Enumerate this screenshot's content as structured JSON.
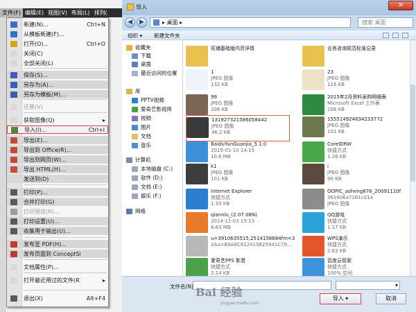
{
  "menubar": {
    "items": [
      "文件(F)",
      "编辑(E)",
      "视图(V)",
      "布局(L)",
      "排列("
    ],
    "active_index": 0
  },
  "file_menu": {
    "items": [
      {
        "label": "新建(N)...",
        "shortcut": "Ctrl+N",
        "color": "#3a6fc8"
      },
      {
        "label": "从模板新建(F)...",
        "shortcut": "",
        "color": "#3a6fc8"
      },
      {
        "label": "打开(O)...",
        "shortcut": "Ctrl+O",
        "color": "#d6a21e"
      },
      {
        "label": "关闭(C)",
        "shortcut": "",
        "color": "#d8d8d8"
      },
      {
        "label": "全部关闭(L)",
        "shortcut": "",
        "color": "#d8d8d8"
      },
      {
        "label": "保存(S)...",
        "shortcut": "",
        "color": "#3a5fb0"
      },
      {
        "label": "另存为(A)...",
        "shortcut": "",
        "color": "#3a5fb0"
      },
      {
        "label": "另存为模板(M)...",
        "shortcut": "",
        "color": "#3a5fb0"
      },
      {
        "label": "还原(V)",
        "shortcut": "",
        "color": "#d8d8d8",
        "disabled": true
      },
      {
        "label": "获取图像(Q)",
        "shortcut": "",
        "color": "#d8d8d8",
        "submenu": true
      },
      {
        "label": "导入(I)...",
        "shortcut": "Ctrl+I",
        "color": "#4f8a3a"
      },
      {
        "label": "导出(E)...",
        "shortcut": "",
        "color": "#c44b3a"
      },
      {
        "label": "导出到 Office(R)...",
        "shortcut": "",
        "color": "#c44b3a"
      },
      {
        "label": "导出到网页(W)...",
        "shortcut": "",
        "color": "#c44b3a"
      },
      {
        "label": "导出 HTML(H)...",
        "shortcut": "",
        "color": "#c44b3a"
      },
      {
        "label": "发送到(D)",
        "shortcut": "",
        "color": "#d8d8d8"
      },
      {
        "label": "打印(P)...",
        "shortcut": "",
        "color": "#5a5a5a"
      },
      {
        "label": "合并打印(G)",
        "shortcut": "",
        "color": "#5a5a5a"
      },
      {
        "label": "打印预览(R)...",
        "shortcut": "",
        "color": "#9a9a9a",
        "disabled": true
      },
      {
        "label": "打印设置(U)...",
        "shortcut": "",
        "color": "#5a5a5a"
      },
      {
        "label": "收集用于输出(U)...",
        "shortcut": "",
        "color": "#5a5a5a"
      },
      {
        "label": "发布至 PDF(H)...",
        "shortcut": "",
        "color": "#c0392b"
      },
      {
        "label": "发布页面到 ConceptShare(I)...",
        "shortcut": "",
        "color": "#c0392b"
      },
      {
        "label": "文档属性(P)...",
        "shortcut": "",
        "color": "#d8d8d8"
      },
      {
        "label": "打开最近用过的文件(R)",
        "shortcut": "",
        "color": "#d8d8d8",
        "submenu": true
      },
      {
        "label": "退出(X)",
        "shortcut": "Alt+F4",
        "color": "#5a5a5a"
      }
    ]
  },
  "dialog": {
    "title": "导入",
    "close_label": "✕",
    "breadcrumb": "▸ 桌面 ▸",
    "search_placeholder": "搜索 桌面",
    "toolbar": {
      "organize": "组织 ▾",
      "new_folder": "新建文件夹"
    },
    "nav": [
      {
        "label": "收藏夹",
        "color": "#e6b32e",
        "indent": 0
      },
      {
        "label": "下载",
        "color": "#6a8fc4",
        "indent": 1
      },
      {
        "label": "桌面",
        "color": "#5e7fb8",
        "indent": 1
      },
      {
        "label": "最近访问的位置",
        "color": "#9cb3d6",
        "indent": 1
      },
      {
        "label": "库",
        "color": "#d9b54a",
        "indent": 0
      },
      {
        "label": "PPTV视频",
        "color": "#2f7fd6",
        "indent": 1
      },
      {
        "label": "爱奇艺影视库",
        "color": "#46a345",
        "indent": 1
      },
      {
        "label": "视频",
        "color": "#8d6fc0",
        "indent": 1
      },
      {
        "label": "图片",
        "color": "#4b8bc9",
        "indent": 1
      },
      {
        "label": "文档",
        "color": "#d8c26a",
        "indent": 1
      },
      {
        "label": "音乐",
        "color": "#4f8fd0",
        "indent": 1
      },
      {
        "label": "计算机",
        "color": "#7a8aa1",
        "indent": 0
      },
      {
        "label": "本地磁盘 (C:)",
        "color": "#9aa7b8",
        "indent": 1
      },
      {
        "label": "软件 (D:)",
        "color": "#9aa7b8",
        "indent": 1
      },
      {
        "label": "文档 (E:)",
        "color": "#9aa7b8",
        "indent": 1
      },
      {
        "label": "娱乐 (F:)",
        "color": "#9aa7b8",
        "indent": 1
      },
      {
        "label": "网络",
        "color": "#5a7bb0",
        "indent": 0
      }
    ],
    "files": [
      {
        "name": "旺铺基础版内页详情",
        "meta1": "",
        "meta2": "",
        "thumb": "#e7c24f",
        "col": 0
      },
      {
        "name": "业务咨询规范标准记录",
        "meta1": "",
        "meta2": "",
        "thumb": "#e7c24f",
        "col": 1
      },
      {
        "name": "1",
        "meta1": "JPEG 图像",
        "meta2": "132 KB",
        "thumb": "#eef3fa",
        "col": 0
      },
      {
        "name": "23",
        "meta1": "JPEG 图像",
        "meta2": "116 KB",
        "thumb": "#ece2c8",
        "col": 1
      },
      {
        "name": "99",
        "meta1": "JPEG 图像",
        "meta2": "206 KB",
        "thumb": "#7a6656",
        "col": 0
      },
      {
        "name": "2015年2月资料采购明细表",
        "meta1": "Microsoft Excel 工作表",
        "meta2": "206 KB",
        "thumb": "#2e8a3f",
        "col": 1
      },
      {
        "name": "131927321586058442",
        "meta1": "JPEG 图像",
        "meta2": "46.2 KB",
        "thumb": "#3a3a3a",
        "col": 0,
        "selected": true
      },
      {
        "name": "155514924634233772",
        "meta1": "JPEG 图像",
        "meta2": "101 KB",
        "thumb": "#6d7a4f",
        "col": 1
      },
      {
        "name": "BaiduYunGuanjia_5.1.0",
        "meta1": "2015-01-10 14:15",
        "meta2": "10.6 MB",
        "thumb": "#3c8fd8",
        "col": 0
      },
      {
        "name": "CorelDRW",
        "meta1": "快捷方式",
        "meta2": "1.26 KB",
        "thumb": "#48a84a",
        "col": 1
      },
      {
        "name": "k1",
        "meta1": "JPEG 图像",
        "meta2": "101 KB",
        "thumb": "#3d3d3d",
        "col": 0
      },
      {
        "name": "i",
        "meta1": "JPEG 图像",
        "meta2": "90 KB",
        "thumb": "#5a4a3f",
        "col": 1
      },
      {
        "name": "Internet Explorer",
        "meta1": "快捷方式",
        "meta2": "1.35 KB",
        "thumb": "#2a7fd0",
        "col": 0
      },
      {
        "name": "OOPIC_asheng876_20091110f",
        "meta1": "361606a7261c01a",
        "meta2": "JPEG 图像",
        "thumb": "#8c8c8c",
        "col": 1
      },
      {
        "name": "qiannlu_(2.07.08N)",
        "meta1": "2014-12-03 15:13",
        "meta2": "6.63 MB",
        "thumb": "#e87a2a",
        "col": 0
      },
      {
        "name": "QQ游戏",
        "meta1": "快捷方式",
        "meta2": "1.17 KB",
        "thumb": "#2aa4d8",
        "col": 1
      },
      {
        "name": "u=3910635515,2514158684fm=3",
        "meta1": "2&s=B9A8C812415825941C79...",
        "meta2": "",
        "thumb": "#b8b8b8",
        "col": 0
      },
      {
        "name": "WPS演示",
        "meta1": "快捷方式",
        "meta2": "2.63 KB",
        "thumb": "#e2552d",
        "col": 1
      },
      {
        "name": "爱奇艺PPS 影音",
        "meta1": "快捷方式",
        "meta2": "2.14 KB",
        "thumb": "#4aa14a",
        "col": 0
      },
      {
        "name": "百度云管家",
        "meta1": "快捷方式",
        "meta2": "100% 空间",
        "thumb": "#3d94db",
        "col": 1
      }
    ],
    "filename_label": "文件名(N):",
    "filename_value": "",
    "filetype_value": "",
    "import_label": "导入",
    "import_arrow": "▾",
    "cancel_label": "取消"
  },
  "watermark": {
    "text": "Bai 经验",
    "sub": "jingyan.baidu.com"
  }
}
